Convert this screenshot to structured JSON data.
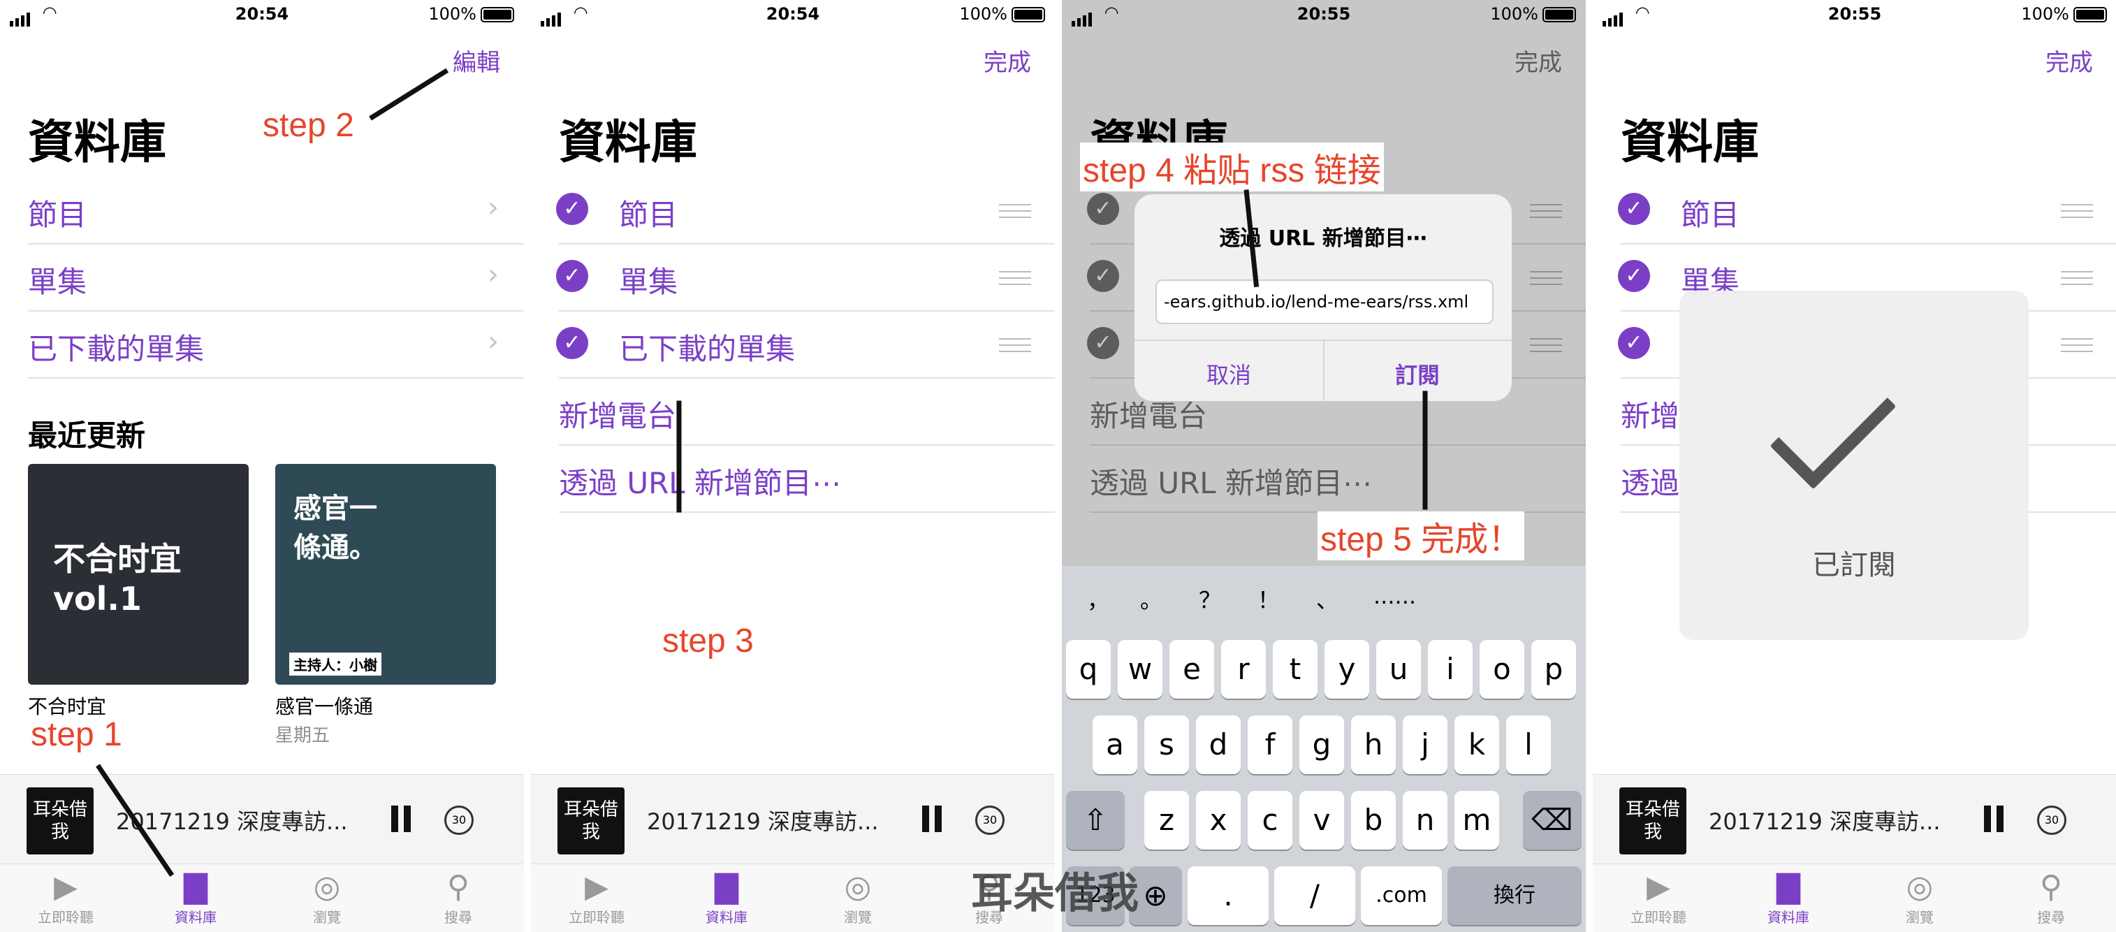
{
  "status": {
    "time_a": "20:54",
    "time_b": "20:55",
    "battery": "100%"
  },
  "screens": {
    "s1": {
      "nav_action": "編輯",
      "title": "資料庫",
      "rows": [
        "節目",
        "單集",
        "已下載的單集"
      ],
      "section": "最近更新",
      "podcasts": [
        {
          "title": "不合时宜",
          "sub": "",
          "art": "不合时宜 vol.1"
        },
        {
          "title": "感官一條通",
          "sub": "星期五",
          "art": "感官一條通。",
          "art_host": "主持人：小樹"
        }
      ]
    },
    "s2": {
      "nav_action": "完成",
      "title": "資料庫",
      "rows": [
        "節目",
        "單集",
        "已下載的單集"
      ],
      "extra": [
        "新增電台",
        "透過 URL 新增節目⋯"
      ]
    },
    "s3": {
      "nav_action": "完成",
      "title": "資料庫",
      "alert_title": "透過 URL 新增節目⋯",
      "url_value": "-ears.github.io/lend-me-ears/rss.xml",
      "cancel": "取消",
      "subscribe": "訂閱",
      "extra": [
        "新增電台",
        "透過 URL 新增節目⋯"
      ],
      "suggestions": [
        "，",
        "。",
        "？",
        "！",
        "、",
        "......"
      ],
      "row1": [
        "q",
        "w",
        "e",
        "r",
        "t",
        "y",
        "u",
        "i",
        "o",
        "p"
      ],
      "row2": [
        "a",
        "s",
        "d",
        "f",
        "g",
        "h",
        "j",
        "k",
        "l"
      ],
      "row3": [
        "z",
        "x",
        "c",
        "v",
        "b",
        "n",
        "m"
      ],
      "numkey": "123",
      "dot": ".",
      "slash": "/",
      "com": ".com",
      "return": "換行"
    },
    "s4": {
      "nav_action": "完成",
      "title": "資料庫",
      "rows": [
        "節目",
        "單集"
      ],
      "extra_partial": [
        "新增",
        "透過"
      ],
      "hud": "已訂閱"
    }
  },
  "player": {
    "episode": "20171219 深度專訪...",
    "thumb": "耳朵借我",
    "skip": "30"
  },
  "tabs": [
    "立即聆聽",
    "資料庫",
    "瀏覽",
    "搜尋"
  ],
  "annotations": {
    "step1": "step 1",
    "step2": "step 2",
    "step3": "step 3",
    "step4": "step 4 粘贴 rss 链接",
    "step5": "step 5 完成！"
  },
  "watermark": "耳朵借我",
  "colors": {
    "accent": "#7b3fc6",
    "annotation": "#e5462b"
  }
}
